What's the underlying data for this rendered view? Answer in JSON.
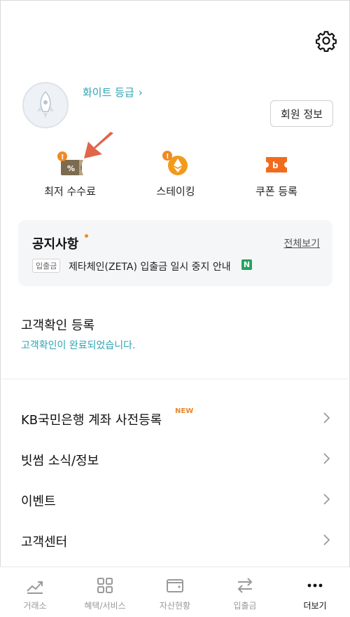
{
  "header": {
    "settings_icon": "gear-icon"
  },
  "profile": {
    "grade": "화이트 등급",
    "member_button": "회원 정보",
    "avatar_icon": "rocket-icon"
  },
  "quick_actions": [
    {
      "label": "최저 수수료",
      "icon": "fee-ticket-icon",
      "alert": "!"
    },
    {
      "label": "스테이킹",
      "icon": "ethereum-coin-icon",
      "alert": "!"
    },
    {
      "label": "쿠폰 등록",
      "icon": "coupon-icon"
    }
  ],
  "notice": {
    "title": "공지사항",
    "view_all": "전체보기",
    "tag": "입출금",
    "text": "제타체인(ZETA) 입출금 일시 중지 안내",
    "new_badge": "N"
  },
  "kyc": {
    "title": "고객확인 등록",
    "status": "고객확인이 완료되었습니다."
  },
  "menu": [
    {
      "label": "KB국민은행 계좌 사전등록",
      "badge": "NEW"
    },
    {
      "label": "빗썸 소식/정보"
    },
    {
      "label": "이벤트"
    },
    {
      "label": "고객센터"
    }
  ],
  "tabs": [
    {
      "label": "거래소",
      "icon": "chart-icon"
    },
    {
      "label": "혜택/서비스",
      "icon": "grid-icon"
    },
    {
      "label": "자산현황",
      "icon": "wallet-icon"
    },
    {
      "label": "입출금",
      "icon": "transfer-icon"
    },
    {
      "label": "더보기",
      "icon": "more-icon",
      "active": true
    }
  ],
  "colors": {
    "accent": "#2da3b3",
    "orange": "#f08a24",
    "new_badge": "#24a35a",
    "arrow": "#e0664a"
  }
}
